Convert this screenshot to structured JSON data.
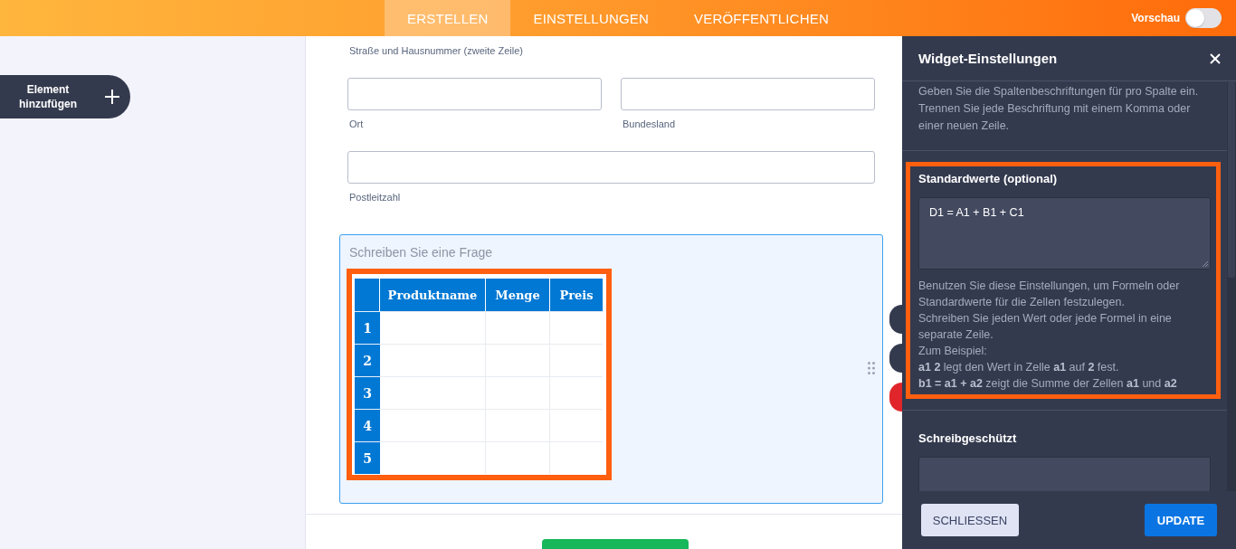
{
  "topbar": {
    "tabs": [
      {
        "label": "ERSTELLEN",
        "selected": true
      },
      {
        "label": "EINSTELLUNGEN",
        "selected": false
      },
      {
        "label": "VERÖFFENTLICHEN",
        "selected": false
      }
    ],
    "preview": {
      "label": "Vorschau",
      "on": false
    }
  },
  "sidebar": {
    "add_button": "Element hinzufügen"
  },
  "form": {
    "address_line_2_label": "Straße und Hausnummer (zweite Zeile)",
    "field_rows": [
      [
        {
          "label": "Ort"
        },
        {
          "label": "Bundesland"
        }
      ],
      [
        {
          "label": "Postleitzahl"
        }
      ]
    ],
    "question": {
      "selected": true,
      "placeholder": "Schreiben Sie eine Frage",
      "table": {
        "highlighted": true,
        "columns": [
          "Produktname",
          "Menge",
          "Preis"
        ],
        "rows": [
          "1",
          "2",
          "3",
          "4",
          "5"
        ]
      }
    },
    "side_buttons": [
      {
        "color": "#343a4e"
      },
      {
        "color": "#343a4e"
      },
      {
        "color": "#e0262a"
      }
    ]
  },
  "settings_panel": {
    "title": "Widget-Einstellungen",
    "intro": "Geben Sie die Spaltenbeschriftungen für pro Spalte ein. Trennen Sie jede Beschriftung mit einem Komma oder einer neuen Zeile.",
    "sections": [
      {
        "title": "Standardwerte (optional)",
        "value": "D1 = A1 + B1 + C1",
        "highlighted": true,
        "help": [
          "Benutzen Sie diese Einstellungen, um Formeln oder Standardwerte für die Zellen festzulegen.",
          "Schreiben Sie jeden Wert oder jede Formel in eine separate Zeile.",
          "Zum Beispiel:",
          "**a1 2** legt den Wert in Zelle **a1** auf **2** fest.",
          "**b1 = a1 + a2** zeigt die Summe der Zellen **a1** und **a2**"
        ]
      },
      {
        "title": "Schreibgeschützt"
      }
    ],
    "buttons": [
      {
        "label": "SCHLIESSEN",
        "kind": "secondary"
      },
      {
        "label": "UPDATE",
        "kind": "primary"
      }
    ]
  }
}
